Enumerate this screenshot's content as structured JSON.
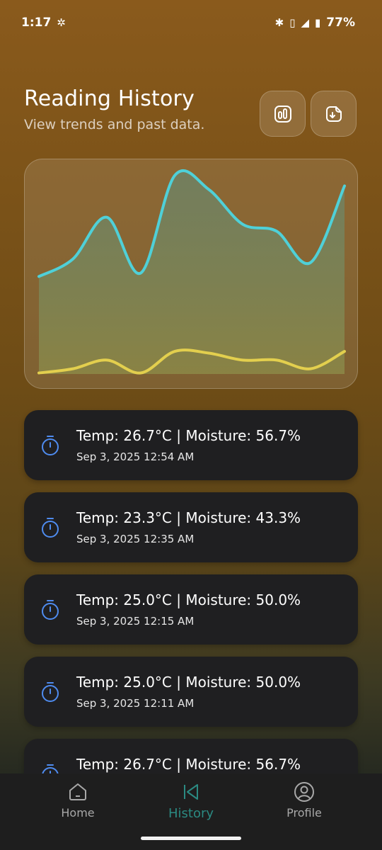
{
  "status_bar": {
    "time": "1:17",
    "battery": "77%"
  },
  "header": {
    "title": "Reading History",
    "subtitle": "View trends and past data."
  },
  "chart_data": {
    "type": "area",
    "x": [
      0,
      1,
      2,
      3,
      4,
      5,
      6,
      7,
      8,
      9
    ],
    "series": [
      {
        "color": "#4fd0d8",
        "values": [
          28,
          33,
          45,
          29,
          57,
          53,
          43,
          41,
          32,
          54
        ]
      },
      {
        "color": "#e3cf4e",
        "values": [
          0.3,
          1.5,
          4,
          0.3,
          6.5,
          6,
          4,
          4,
          1.5,
          6.5
        ]
      }
    ],
    "ylim": [
      0,
      60
    ],
    "grid": false
  },
  "readings": [
    {
      "title": "Temp: 26.7°C | Moisture: 56.7%",
      "date": "Sep 3, 2025 12:54 AM"
    },
    {
      "title": "Temp: 23.3°C | Moisture: 43.3%",
      "date": "Sep 3, 2025 12:35 AM"
    },
    {
      "title": "Temp: 25.0°C | Moisture: 50.0%",
      "date": "Sep 3, 2025 12:15 AM"
    },
    {
      "title": "Temp: 25.0°C | Moisture: 50.0%",
      "date": "Sep 3, 2025 12:11 AM"
    },
    {
      "title": "Temp: 26.7°C | Moisture: 56.7%",
      "date": ""
    }
  ],
  "nav": {
    "home": "Home",
    "history": "History",
    "profile": "Profile"
  },
  "colors": {
    "accent": "#2b8a82",
    "icon_blue": "#4f8cf0"
  }
}
